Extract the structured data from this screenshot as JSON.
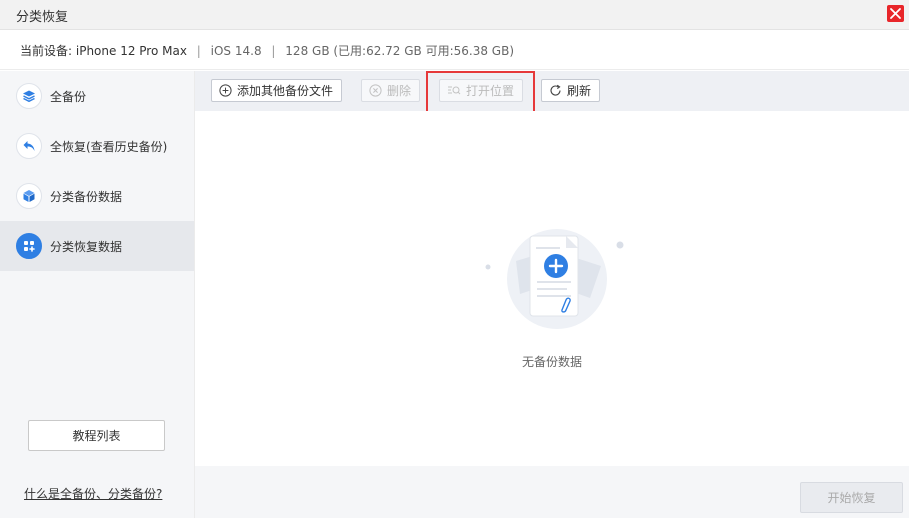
{
  "window": {
    "title": "分类恢复",
    "close_icon": "close-icon"
  },
  "device": {
    "label": "当前设备:",
    "name": "iPhone 12 Pro Max",
    "separator": "|",
    "ios": "iOS 14.8",
    "storage": "128 GB (已用:62.72 GB 可用:56.38 GB)"
  },
  "sidebar": {
    "items": [
      {
        "label": "全备份",
        "icon": "layers-icon",
        "active": false
      },
      {
        "label": "全恢复(查看历史备份)",
        "icon": "undo-arrow-icon",
        "active": false
      },
      {
        "label": "分类备份数据",
        "icon": "cube-icon",
        "active": false
      },
      {
        "label": "分类恢复数据",
        "icon": "grid-icon",
        "active": true
      }
    ],
    "tutorial_button": "教程列表",
    "help_link": "什么是全备份、分类备份?"
  },
  "toolbar": {
    "add_label": "添加其他备份文件",
    "delete_label": "删除",
    "open_location_label": "打开位置",
    "refresh_label": "刷新"
  },
  "content": {
    "empty_text": "无备份数据",
    "illustration": "empty-document-plus-icon"
  },
  "footer": {
    "start_restore_label": "开始恢复"
  },
  "colors": {
    "accent": "#2f7fe3",
    "close": "#e8262a",
    "highlight": "#e6393a"
  }
}
